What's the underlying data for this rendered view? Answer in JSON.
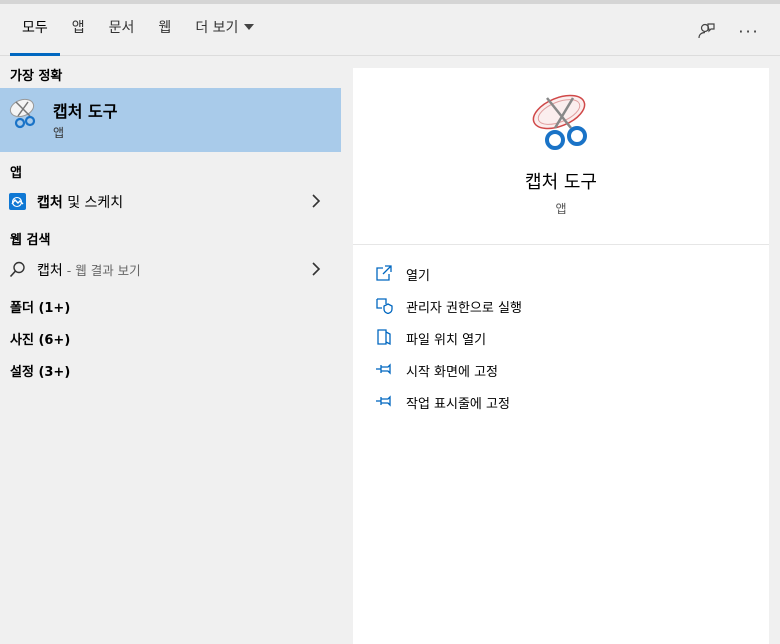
{
  "tabs": [
    {
      "label": "모두"
    },
    {
      "label": "앱"
    },
    {
      "label": "문서"
    },
    {
      "label": "웹"
    },
    {
      "label": "더 보기"
    }
  ],
  "left": {
    "best_match_header": "가장 정확",
    "best_match": {
      "title": "캡처 도구",
      "subtitle": "앱"
    },
    "apps_header": "앱",
    "app_result": {
      "bold": "캡처",
      "rest": " 및 스케치"
    },
    "web_header": "웹 검색",
    "web_result": {
      "query": "캡처",
      "suffix": " - 웹 결과 보기"
    },
    "folders": "폴더 (1+)",
    "photos": "사진 (6+)",
    "settings": "설정 (3+)"
  },
  "detail": {
    "title": "캡처 도구",
    "subtitle": "앱",
    "actions": [
      {
        "label": "열기",
        "icon": "open-icon"
      },
      {
        "label": "관리자 권한으로 실행",
        "icon": "shield-icon"
      },
      {
        "label": "파일 위치 열기",
        "icon": "file-location-icon"
      },
      {
        "label": "시작 화면에 고정",
        "icon": "pin-icon"
      },
      {
        "label": "작업 표시줄에 고정",
        "icon": "pin-icon"
      }
    ]
  },
  "colors": {
    "accent": "#0067c0",
    "selected_bg": "#a9cbea",
    "panel_bg": "#f0f0f0"
  }
}
